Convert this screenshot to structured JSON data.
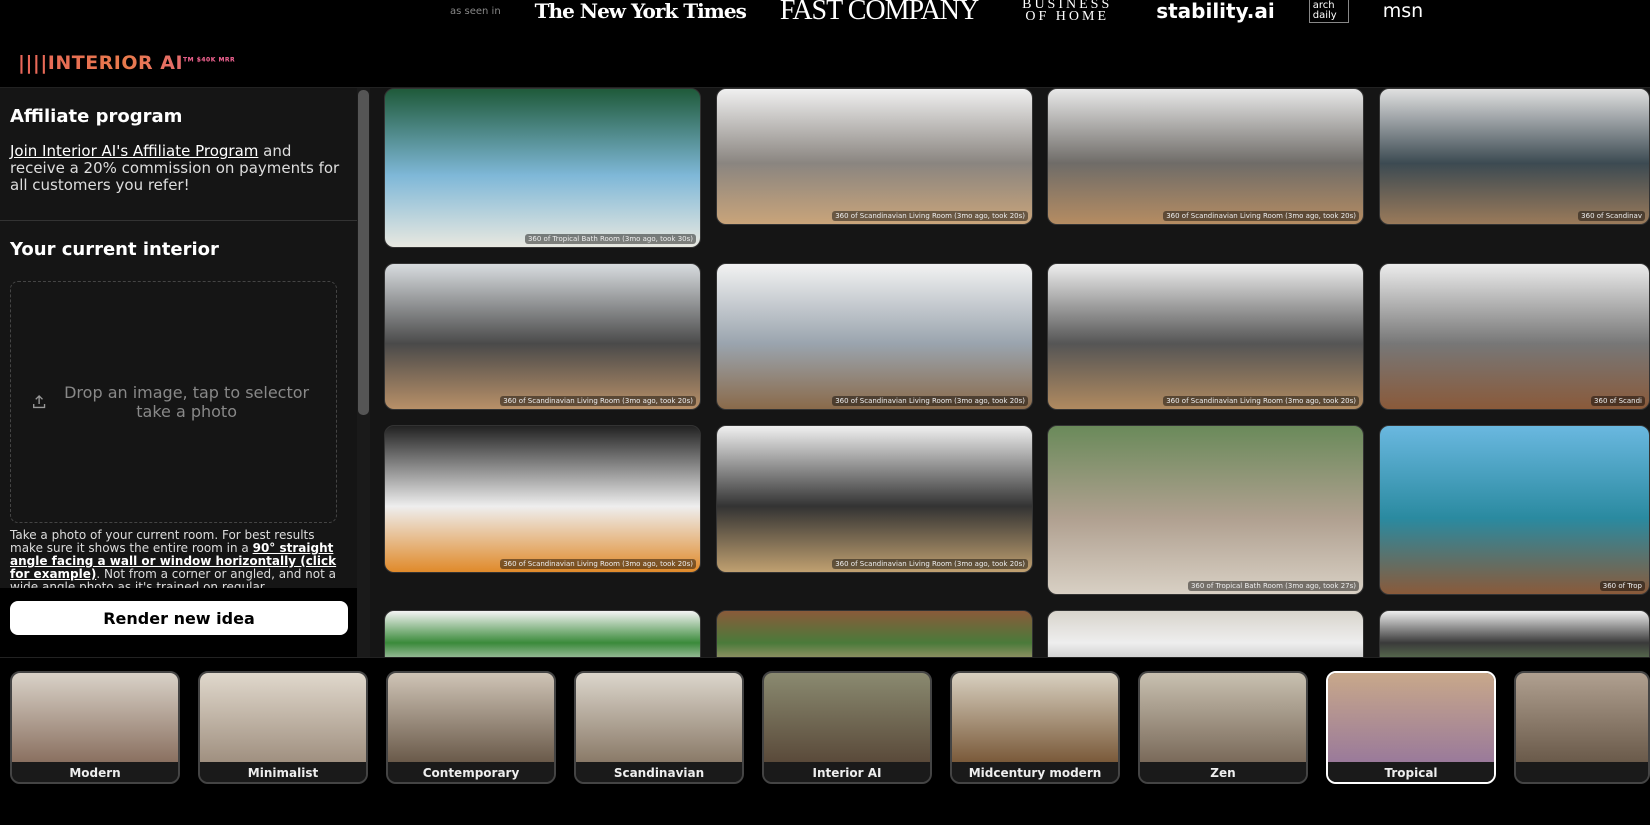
{
  "header": {
    "as_seen_in": "as seen in",
    "press": [
      "The New York Times",
      "FAST COMPANY",
      "BUSINESS OF HOME",
      "stability.ai",
      "arch daily",
      "msn"
    ],
    "logo": "||||INTERIOR AI",
    "logo_badge": "TM $40K MRR",
    "brand_color": "#e8655a"
  },
  "sidebar": {
    "affiliate_title": "Affiliate program",
    "affiliate_link": "Join Interior AI's Affiliate Program",
    "affiliate_text": " and receive a 20% commission on payments for all customers you refer!",
    "current_title": "Your current interior",
    "drop_text": "Drop an image, tap to selector take a photo",
    "help_a": "Take a photo of your current room. For best results make sure it shows the entire room in a ",
    "help_link": "90° straight angle facing a wall or window horizontally (click for example)",
    "help_b": ". Not from a corner or angled, and not a wide angle photo as it's trained on regular",
    "render_button": "Render new idea"
  },
  "gallery": [
    {
      "caption": "360 of Tropical Bath Room (3mo ago, took 30s)",
      "colors": [
        "#1f5a3a",
        "#7fb8d8",
        "#e8e8e0"
      ]
    },
    {
      "caption": "360 of Scandinavian Living Room (3mo ago, took 20s)",
      "colors": [
        "#f0f0f0",
        "#8a8580",
        "#c9a47a"
      ]
    },
    {
      "caption": "360 of Scandinavian Living Room (3mo ago, took 20s)",
      "colors": [
        "#e8e8e8",
        "#6f6c68",
        "#b58c62"
      ]
    },
    {
      "caption": "360 of Scandinav",
      "colors": [
        "#e0e0e0",
        "#3c4a52",
        "#9a7a5a"
      ]
    },
    {
      "caption": "360 of Scandinavian Living Room (3mo ago, took 20s)",
      "colors": [
        "#d8dcdf",
        "#4a4a4a",
        "#b89068"
      ]
    },
    {
      "caption": "360 of Scandinavian Living Room (3mo ago, took 20s)",
      "colors": [
        "#f2f2f2",
        "#9aa4ae",
        "#8a6a4a"
      ]
    },
    {
      "caption": "360 of Scandinavian Living Room (3mo ago, took 20s)",
      "colors": [
        "#eeeeee",
        "#555",
        "#b08a60"
      ]
    },
    {
      "caption": "360 of Scandi",
      "colors": [
        "#ececec",
        "#777",
        "#8a5a3a"
      ]
    },
    {
      "caption": "360 of Scandinavian Living Room (3mo ago, took 20s)",
      "colors": [
        "#222",
        "#eee",
        "#e08a2a"
      ]
    },
    {
      "caption": "360 of Scandinavian Living Room (3mo ago, took 20s)",
      "colors": [
        "#f0f0f0",
        "#333",
        "#c0a070"
      ]
    },
    {
      "caption": "360 of Tropical Bath Room (3mo ago, took 27s)",
      "colors": [
        "#6a8a5a",
        "#b0a090",
        "#d8d0c4"
      ]
    },
    {
      "caption": "360 of Trop",
      "colors": [
        "#6ab8e0",
        "#2a8aa0",
        "#8a5a3a"
      ]
    },
    {
      "caption": "",
      "colors": [
        "#f4f4f4",
        "#3a8a3a",
        "#ddd"
      ]
    },
    {
      "caption": "",
      "colors": [
        "#8a5a3a",
        "#4a7a3a",
        "#c0a080"
      ]
    },
    {
      "caption": "",
      "colors": [
        "#d8d4cc",
        "#eee",
        "#bbb"
      ]
    },
    {
      "caption": "",
      "colors": [
        "#eee",
        "#3a3a3a",
        "#6a8a5a"
      ]
    }
  ],
  "styles": [
    {
      "label": "Modern",
      "colors": [
        "#d9d2c8",
        "#8a7060"
      ]
    },
    {
      "label": "Minimalist",
      "colors": [
        "#e0d8cc",
        "#a09080"
      ]
    },
    {
      "label": "Contemporary",
      "colors": [
        "#cfc4b6",
        "#6a5a4a"
      ]
    },
    {
      "label": "Scandinavian",
      "colors": [
        "#dcd6cc",
        "#8a7a68"
      ]
    },
    {
      "label": "Interior AI",
      "colors": [
        "#8a8a70",
        "#5a4a3a"
      ]
    },
    {
      "label": "Midcentury modern",
      "colors": [
        "#d8d0c0",
        "#7a5a3a"
      ]
    },
    {
      "label": "Zen",
      "colors": [
        "#c8c0b0",
        "#7a6a5a"
      ]
    },
    {
      "label": "Tropical",
      "colors": [
        "#c8a88a",
        "#9a7a9a"
      ],
      "selected": true
    },
    {
      "label": "",
      "colors": [
        "#b0a090",
        "#6a5a4a"
      ]
    }
  ]
}
